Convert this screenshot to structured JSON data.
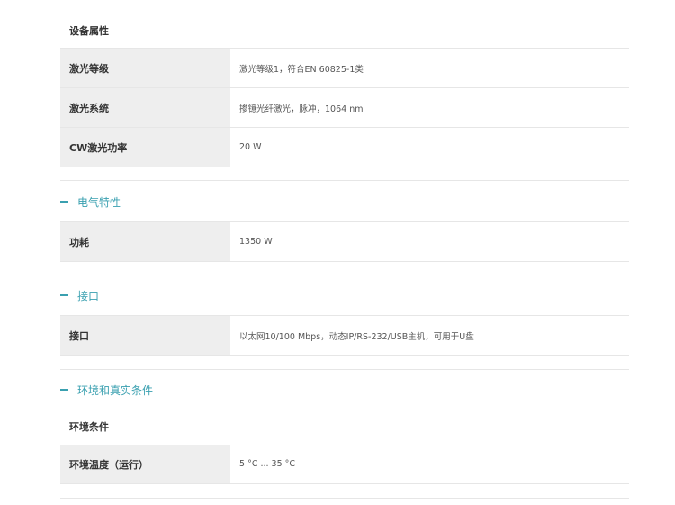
{
  "device": {
    "heading": "设备属性",
    "rows": [
      {
        "label": "激光等级",
        "value": "激光等级1，符合EN 60825-1类"
      },
      {
        "label": "激光系统",
        "value": "掺镱光纤激光，脉冲，1064 nm"
      },
      {
        "label": "CW激光功率",
        "value": "20 W"
      }
    ]
  },
  "electrical": {
    "title": "电气特性",
    "rows": [
      {
        "label": "功耗",
        "value": "1350 W"
      }
    ]
  },
  "interface": {
    "title": "接口",
    "rows": [
      {
        "label": "接口",
        "value": "以太网10/100 Mbps，动态IP/RS-232/USB主机，可用于U盘"
      }
    ]
  },
  "environment": {
    "title": "环境和真实条件",
    "heading": "环境条件",
    "rows": [
      {
        "label": "环境温度（运行）",
        "value": "5 °C ... 35 °C"
      }
    ]
  },
  "toggle_icon": "minus-icon",
  "accent_color": "#3aa0b0"
}
